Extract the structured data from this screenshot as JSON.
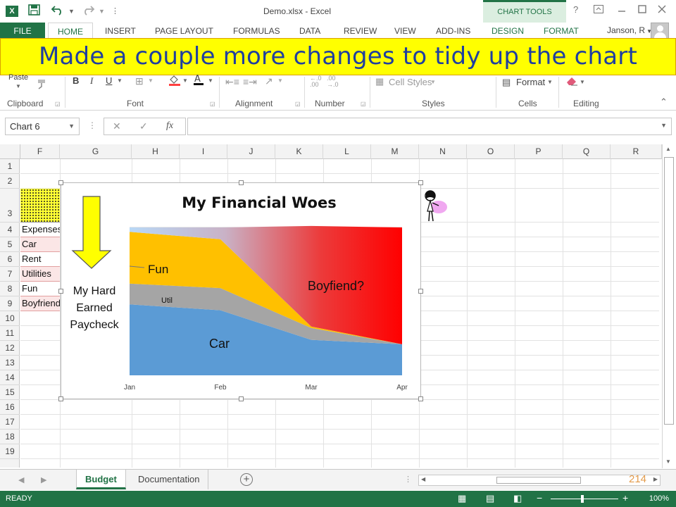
{
  "window": {
    "title": "Demo.xlsx - Excel",
    "context_tab": "CHART TOOLS",
    "user": "Janson, R",
    "app_icon": "excel-icon",
    "min_icon": "minimize-icon",
    "restore_icon": "restore-icon",
    "close_icon": "close-icon"
  },
  "ribbon_tabs": [
    "FILE",
    "HOME",
    "INSERT",
    "PAGE LAYOUT",
    "FORMULAS",
    "DATA",
    "REVIEW",
    "VIEW",
    "ADD-INS",
    "DESIGN",
    "FORMAT"
  ],
  "active_tab": "HOME",
  "banner": "Made a couple more changes to tidy up the chart",
  "ribbon": {
    "paste": "Paste",
    "groups": [
      "Clipboard",
      "Font",
      "Alignment",
      "Number",
      "Styles",
      "Cells",
      "Editing"
    ],
    "cell_styles": "Cell Styles",
    "format": "Format",
    "bold": "B",
    "italic": "I",
    "underline": "U"
  },
  "formula_bar": {
    "name_box": "Chart 6",
    "fx": "fx",
    "cancel": "✕",
    "enter": "✓",
    "value": ""
  },
  "columns": [
    "F",
    "G",
    "H",
    "I",
    "J",
    "K",
    "L",
    "M",
    "N",
    "O",
    "P",
    "Q",
    "R"
  ],
  "rows": [
    "1",
    "2",
    "3",
    "4",
    "5",
    "6",
    "7",
    "8",
    "9",
    "10",
    "11",
    "12",
    "13",
    "14",
    "15",
    "16",
    "17",
    "18",
    "19"
  ],
  "cells_f": [
    "Expenses",
    "Car",
    "Rent",
    "Utilities",
    "Fun",
    "Boyfriend"
  ],
  "chart_data": {
    "type": "area",
    "stacked": true,
    "title": "My Financial Woes",
    "categories": [
      "Jan",
      "Feb",
      "Mar",
      "Apr"
    ],
    "series": [
      {
        "name": "Car",
        "values": [
          48,
          44,
          24,
          21
        ],
        "color": "#5b9bd5"
      },
      {
        "name": "Util",
        "values": [
          14,
          15,
          8,
          0
        ],
        "color": "#a5a5a5"
      },
      {
        "name": "Fun",
        "values": [
          35,
          33,
          1,
          0
        ],
        "color": "#ffc000"
      },
      {
        "name": "Boyfiend?",
        "values": [
          3,
          8,
          68,
          79
        ],
        "color": "#ff0000"
      }
    ],
    "ylim": [
      0,
      100
    ],
    "grid": false,
    "legend": "none",
    "annotations": [
      "Fun",
      "Util",
      "Car",
      "Boyfiend?"
    ]
  },
  "left_note": {
    "line1": "My Hard",
    "line2": "Earned",
    "line3": "Paycheck"
  },
  "sheets": [
    "Budget",
    "Documentation"
  ],
  "active_sheet": "Budget",
  "page_number": "214",
  "status": {
    "ready": "READY",
    "zoom": "100%"
  }
}
